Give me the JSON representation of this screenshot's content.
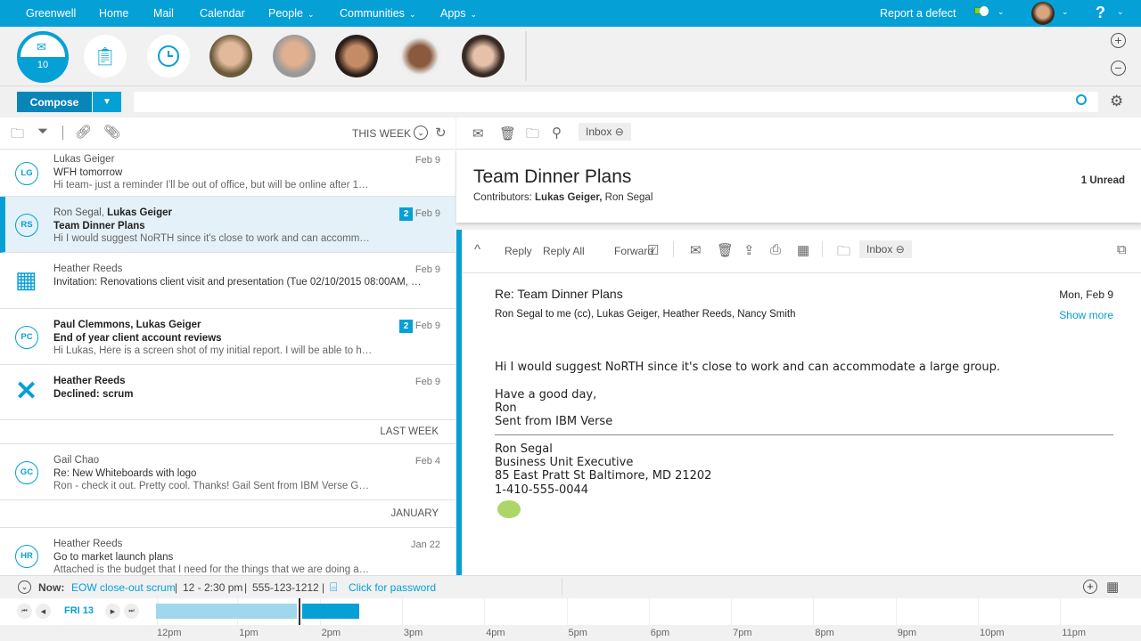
{
  "topbar": {
    "brand": "Greenwell",
    "nav": [
      "Home",
      "Mail",
      "Calendar",
      "People",
      "Communities",
      "Apps"
    ],
    "report": "Report a defect"
  },
  "mail_counter": "10",
  "compose": "Compose",
  "search": {
    "placeholder": "",
    "value": ""
  },
  "list": {
    "filter": "THIS WEEK",
    "items": [
      {
        "initials": "LG",
        "from": "Lukas Geiger",
        "from_bold": "",
        "subject": "WFH tomorrow",
        "subject_bold": false,
        "preview": "Hi team- just a reminder I'll be out of office, but will be online after 1…",
        "date": "Feb 9",
        "count": "",
        "kind": "initials"
      },
      {
        "initials": "RS",
        "from": "Ron Segal, ",
        "from_bold": "Lukas Geiger",
        "subject": "Team Dinner Plans",
        "subject_bold": true,
        "preview": "Hi I would suggest NoRTH since it's close to work and can accomm…",
        "date": "Feb 9",
        "count": "2",
        "kind": "initials",
        "selected": true
      },
      {
        "initials": "",
        "from": "Heather Reeds",
        "from_bold": "",
        "subject": "Invitation: Renovations client visit and presentation (Tue 02/10/2015 08:00AM, …",
        "subject_bold": false,
        "preview": "",
        "date": "Feb 9",
        "count": "",
        "kind": "calendar"
      },
      {
        "initials": "PC",
        "from": "",
        "from_bold": "Paul Clemmons, Lukas Geiger",
        "subject": "End of year client account reviews",
        "subject_bold": true,
        "preview": "Hi Lukas, Here is a screen shot of my initial report. I will be able to h…",
        "date": "Feb 9",
        "count": "2",
        "kind": "initials"
      },
      {
        "initials": "",
        "from": "",
        "from_bold": "Heather Reeds",
        "subject": "Declined: scrum",
        "subject_bold": true,
        "preview": "",
        "date": "Feb 9",
        "count": "",
        "kind": "declined"
      },
      {
        "section": "LAST WEEK"
      },
      {
        "initials": "GC",
        "from": "Gail Chao",
        "from_bold": "",
        "subject": "Re: New Whiteboards with logo",
        "subject_bold": false,
        "preview": "Ron - check it out. Pretty cool. Thanks! Gail Sent from IBM Verse G…",
        "date": "Feb 4",
        "count": "",
        "kind": "initials"
      },
      {
        "section": "JANUARY"
      },
      {
        "initials": "HR",
        "from": "Heather Reeds",
        "from_bold": "",
        "subject": "Go to market launch plans",
        "subject_bold": false,
        "preview": "Attached is the budget that I need for the things that we are doing a…",
        "date": "Jan 22",
        "count": "",
        "kind": "initials"
      }
    ]
  },
  "thread": {
    "folder": "Inbox",
    "title": "Team Dinner Plans",
    "contributors_label": "Contributors: ",
    "contributor_bold": "Lukas Geiger,",
    "contributor_other": " Ron Segal",
    "unread": "1 Unread"
  },
  "message": {
    "reply": "Reply",
    "reply_all": "Reply All",
    "forward": "Forward",
    "folder": "Inbox",
    "subject": "Re: Team Dinner Plans",
    "date": "Mon, Feb 9",
    "recipients": "Ron Segal to me (cc), Lukas Geiger, Heather Reeds, Nancy Smith",
    "show_more": "Show more",
    "body": [
      "Hi I would suggest NoRTH since it's close to work and can accommodate a large group.",
      "Have a good day,",
      "Ron",
      "Sent from IBM Verse"
    ],
    "signature": [
      "Ron Segal",
      "Business Unit Executive",
      "85 East Pratt St Baltimore, MD 21202",
      "1-410-555-0044"
    ]
  },
  "now": {
    "label": "Now:",
    "event": "EOW close-out scrum",
    "time": "12 - 2:30 pm",
    "phone": "555-123-1212",
    "password": "Click for password"
  },
  "timeline": {
    "day": "FRI 13",
    "hours": [
      "12pm",
      "1pm",
      "2pm",
      "3pm",
      "4pm",
      "5pm",
      "6pm",
      "7pm",
      "8pm",
      "9pm",
      "10pm",
      "11pm"
    ]
  },
  "colors": {
    "accent": "#05a0d6",
    "selected_row": "#e4f1f8"
  }
}
